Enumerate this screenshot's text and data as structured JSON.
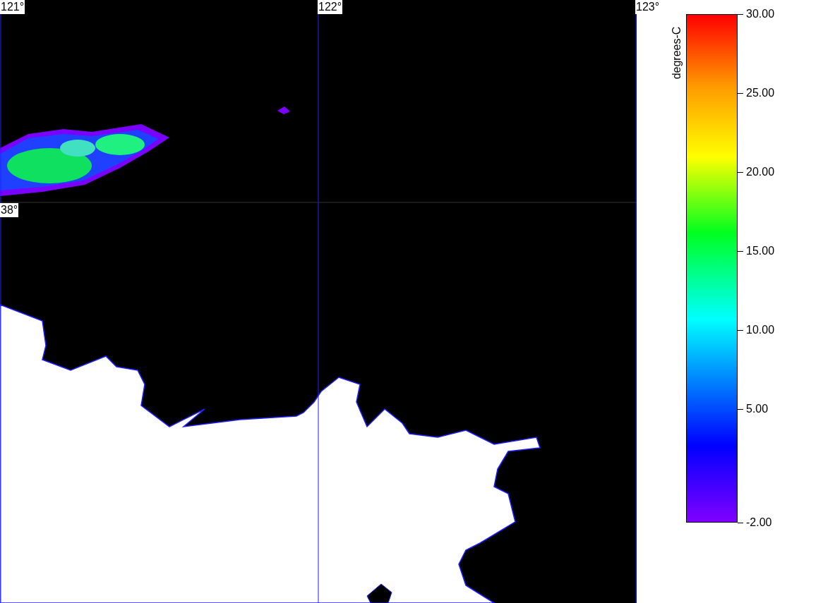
{
  "map": {
    "longitude_labels": [
      "121°",
      "122°",
      "123°"
    ],
    "latitude_labels": [
      "38°"
    ]
  },
  "colorbar": {
    "unit": "degrees-C",
    "labels": [
      "30.00",
      "25.00",
      "20.00",
      "15.00",
      "10.00",
      "5.00",
      "-2.00"
    ]
  }
}
